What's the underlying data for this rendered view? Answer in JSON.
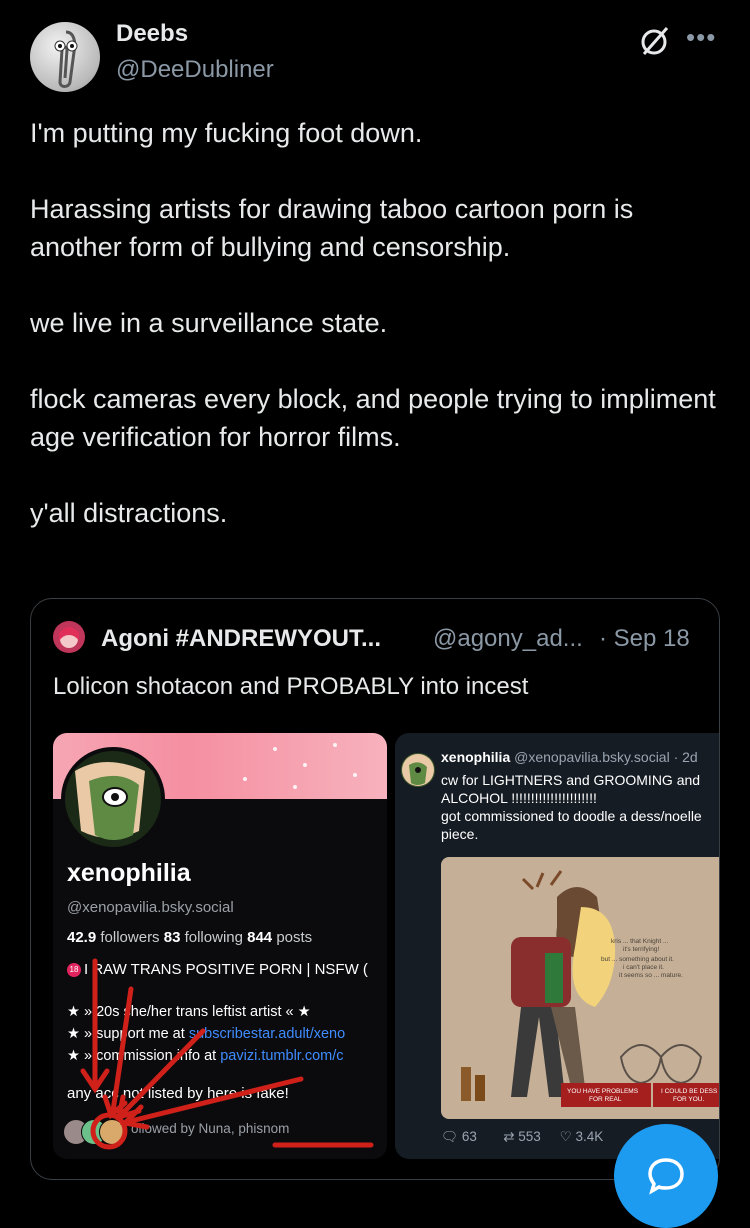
{
  "author": {
    "name": "Deebs",
    "handle": "@DeeDubliner"
  },
  "icons": {
    "grok": "grok-slash-circle-icon",
    "more": "more-dots-icon",
    "reply_fab": "compose-reply-icon"
  },
  "tweet": {
    "paragraphs": [
      "I'm putting my fucking foot down.",
      "Harassing artists for drawing taboo cartoon porn is another form of bullying and censorship.",
      "we live in a surveillance state.",
      "flock cameras every block, and people trying to impliment age verification for horror films.",
      "y'all distractions."
    ]
  },
  "quote": {
    "name": "Agoni #ANDREWYOUT...",
    "handle": "@agony_ad...",
    "date": "· Sep 18",
    "text": "Lolicon shotacon and PROBABLY into incest",
    "profile": {
      "name": "xenophilia",
      "handle": "@xenopavilia.bsky.social",
      "followers_count": "42.9",
      "followers_label": " followers ",
      "following_count": "83",
      "following_label": " following ",
      "posts_count": "844",
      "posts_label": " posts",
      "nsfw_line": "I  RAW TRANS POSITIVE PORN | NSFW (",
      "bio1": "★ » 20s she/her trans leftist artist « ★",
      "bio2_prefix": "★ » support me at ",
      "bio2_link": "subscribestar.adult/xeno",
      "bio3_prefix": "★ » commission info at ",
      "bio3_link": "pavizi.tumblr.com/c",
      "note": "any acc      not listed by      here is fake!",
      "followed_by": "ollowed by Nuna, phisnom"
    },
    "post": {
      "name": "xenophilia",
      "meta": " @xenopavilia.bsky.social · 2d",
      "line1": "cw for LIGHTNERS and GROOMING and ALCOHOL !!!!!!!!!!!!!!!!!!!!!!",
      "line2": "got commissioned to doodle a dess/noelle piece.",
      "art_text1": "kris ... that Knight ...",
      "art_text2": "it's terrifying!",
      "art_text3": "but ... something about it.",
      "art_text4": "i can't place it.",
      "art_text5": "it seems so ... mature.",
      "art_caption1": "YOU HAVE PROBLEMS",
      "art_caption2": "FOR REAL",
      "art_caption3": "I COULD BE DESS",
      "art_caption4": "FOR YOU.",
      "replies": "63",
      "reposts": "553",
      "likes": "3.4K"
    }
  },
  "annotation_color": "#d0201a",
  "accent": "#1d9bf0"
}
